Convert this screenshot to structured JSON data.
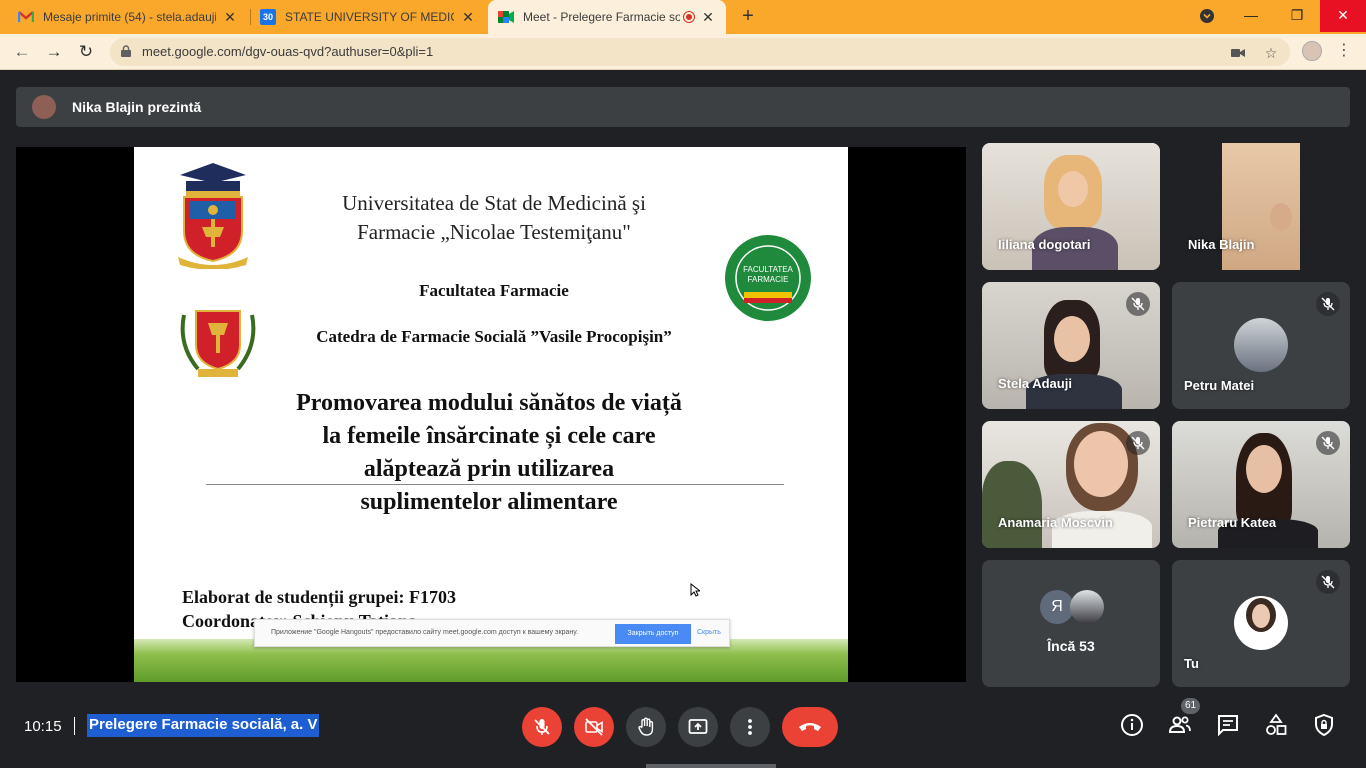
{
  "browser": {
    "tabs": [
      {
        "title": "Mesaje primite (54) - stela.adauji",
        "icon": "gmail-icon"
      },
      {
        "title": "STATE UNIVERSITY OF MEDICINE",
        "icon": "calendar-icon",
        "favicon_text": "30"
      },
      {
        "title": "Meet - Prelegere Farmacie so",
        "icon": "meet-icon"
      }
    ],
    "url": "meet.google.com/dgv-ouas-qvd?authuser=0&pli=1",
    "colors": {
      "frame": "#f9a82c",
      "toolbar": "#fcefdc"
    }
  },
  "meet": {
    "presenter_text": "Nika Blajin prezintă",
    "slide": {
      "university_line1": "Universitatea de Stat de Medicină şi",
      "university_line2": "Farmacie „Nicolae Testemiţanu\"",
      "faculty": "Facultatea Farmacie",
      "department": "Catedra de Farmacie Socială ”Vasile Procopişin”",
      "topic_line1": "Promovarea modului sănătos de viață",
      "topic_line2": "la femeile însărcinate și cele care",
      "topic_line3": "alăptează prin utilizarea",
      "topic_line4": "suplimentelor  alimentare",
      "elaborated": "Elaborat de studenții grupei: F1703",
      "coordinator": "Coordonator: Schiopu Tatiana",
      "green_logo_text1": "FACULTATEA",
      "green_logo_text2": "FARMACIE"
    },
    "share_notice": {
      "text": "Приложение \"Google Hangouts\" предоставило сайту meet.google.com доступ к вашему экрану.",
      "stop_button": "Закрыть доступ",
      "hide_button": "Скрыть"
    },
    "participants": [
      {
        "name": "Iiliana dogotari",
        "muted": false
      },
      {
        "name": "Nika Blajin",
        "muted": false
      },
      {
        "name": "Stela Adauji",
        "muted": true
      },
      {
        "name": "Petru Matei",
        "muted": true
      },
      {
        "name": "Anamaria Moscvin",
        "muted": true
      },
      {
        "name": "Pietraru Katea",
        "muted": true
      },
      {
        "name": "Încă 53",
        "muted": false,
        "initial": "Я"
      },
      {
        "name": "Tu",
        "muted": true
      }
    ],
    "bottom": {
      "time": "10:15",
      "meeting_title": "Prelegere Farmacie socială, a. V",
      "people_count": "61"
    },
    "colors": {
      "background": "#202124",
      "tile": "#3c4043",
      "danger": "#ea4335",
      "selection": "#1d5fd3"
    }
  }
}
